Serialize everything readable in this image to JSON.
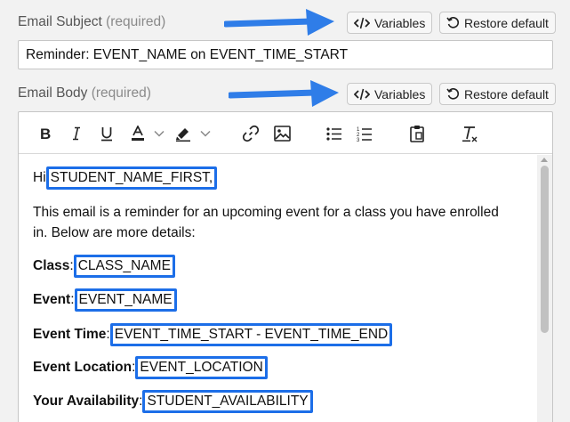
{
  "subject": {
    "label": "Email Subject",
    "required": "(required)",
    "value": "Reminder: EVENT_NAME on EVENT_TIME_START",
    "variables_label": "Variables",
    "restore_label": "Restore default"
  },
  "body": {
    "label": "Email Body",
    "required": "(required)",
    "variables_label": "Variables",
    "restore_label": "Restore default",
    "lines": {
      "greeting_prefix": "Hi",
      "greeting_var": "STUDENT_NAME_FIRST,",
      "intro_1": "This email is a reminder for an upcoming event for a class you have enrolled",
      "intro_2": "in. Below are more details:",
      "class_label": "Class",
      "class_var": "CLASS_NAME",
      "event_label": "Event",
      "event_var": "EVENT_NAME",
      "time_label": "Event Time",
      "time_var": "EVENT_TIME_START - EVENT_TIME_END",
      "location_label": "Event Location",
      "location_var": "EVENT_LOCATION",
      "availability_label": "Your Availability",
      "availability_var": "STUDENT_AVAILABILITY"
    }
  },
  "toolbar_icons": [
    "bold-icon",
    "italic-icon",
    "underline-icon",
    "text-color-icon",
    "highlight-icon",
    "link-icon",
    "image-icon",
    "bullet-list-icon",
    "numbered-list-icon",
    "paste-icon",
    "clear-format-icon"
  ],
  "colors": {
    "accent": "#1c6ee8",
    "arrow": "#2f7de8"
  }
}
